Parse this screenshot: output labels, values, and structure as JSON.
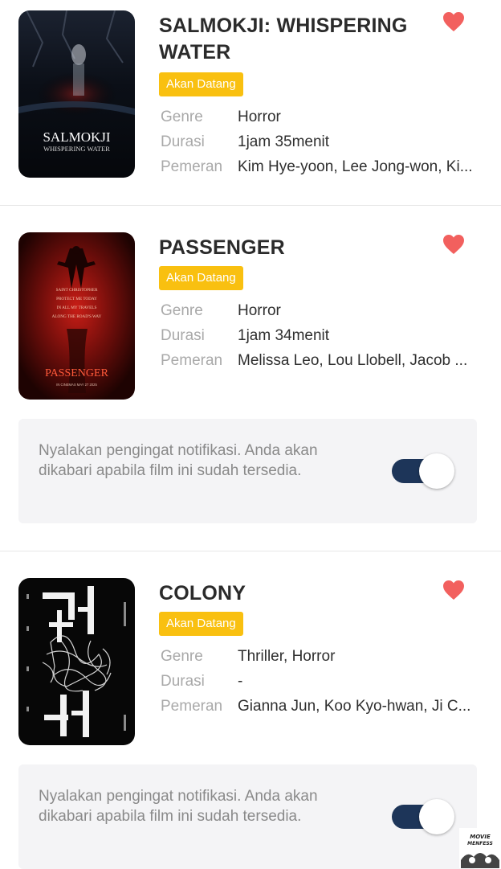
{
  "labels": {
    "genre": "Genre",
    "duration": "Durasi",
    "cast": "Pemeran"
  },
  "status_badge": "Akan Datang",
  "accent_colors": {
    "badge": "#f9c010",
    "heart": "#f2605e",
    "toggle_on": "#1d3559"
  },
  "reminder_text": "Nyalakan pengingat notifikasi. Anda akan dikabari apabila film ini sudah tersedia.",
  "movies": [
    {
      "title": "SALMOKJI: WHISPERING WATER",
      "favorite_icon": "heart-icon",
      "favorited": true,
      "poster": {
        "title": "SALMOKJI",
        "subtitle": "WHISPERING WATER"
      },
      "genre": "Horror",
      "duration": "1jam 35menit",
      "cast": "Kim Hye-yoon, Lee Jong-won, Ki..."
    },
    {
      "title": "PASSENGER",
      "favorite_icon": "heart-icon",
      "favorited": true,
      "poster": {
        "title": "PASSENGER",
        "tagline": [
          "SAINT CHRISTOPHER",
          "PROTECT ME TODAY",
          "IN ALL MY TRAVELS",
          "ALONG THE ROAD'S WAY"
        ],
        "footer": "IN CINEMAS MAY 27 2025"
      },
      "genre": "Horror",
      "duration": "1jam 34menit",
      "cast": "Melissa Leo, Lou Llobell, Jacob ...",
      "reminder_on": true
    },
    {
      "title": "COLONY",
      "favorite_icon": "heart-icon",
      "favorited": true,
      "poster": {
        "glyphs": "군체"
      },
      "genre": "Thriller, Horror",
      "duration": "-",
      "cast": "Gianna Jun, Koo Kyo-hwan, Ji C...",
      "reminder_on": true
    }
  ],
  "watermark": {
    "line1": "MOVIE",
    "line2": "MENFESS"
  }
}
